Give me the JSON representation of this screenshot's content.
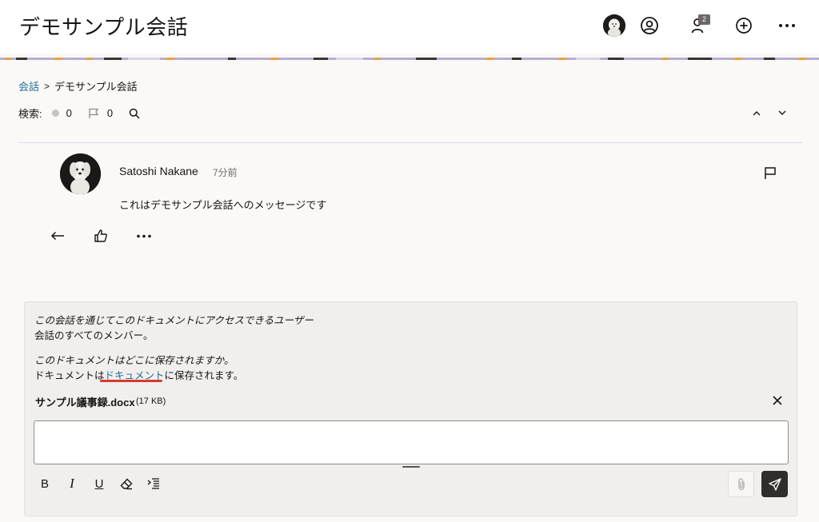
{
  "header": {
    "title": "デモサンプル会話",
    "participants_badge": "2",
    "icons": [
      "user-avatar",
      "profile-icon",
      "participants-icon",
      "add-icon",
      "more-icon"
    ]
  },
  "breadcrumb": {
    "root": "会話",
    "separator": ">",
    "current": "デモサンプル会話"
  },
  "search": {
    "label": "検索:",
    "unread_count": "0",
    "flag_count": "0"
  },
  "message": {
    "author": "Satoshi Nakane",
    "time": "7分前",
    "text": "これはデモサンプル会話へのメッセージです"
  },
  "compose": {
    "access_heading": "この会話を通じてこのドキュメントにアクセスできるユーザー",
    "access_value": "会話のすべてのメンバー。",
    "location_heading": "このドキュメントはどこに保存されますか。",
    "location_prefix": "ドキュメントは",
    "location_link": "ドキュメント",
    "location_suffix": "に保存されます。",
    "file_name": "サンプル議事録.docx",
    "file_size": "(17 KB)",
    "input_value": "",
    "toolbar": {
      "bold": "B",
      "italic": "I",
      "underline": "U"
    }
  },
  "colors": {
    "link": "#1f6e96",
    "highlight": "#d83a2e",
    "send_button": "#312d2a",
    "banner_primary": "#b8aed0"
  }
}
